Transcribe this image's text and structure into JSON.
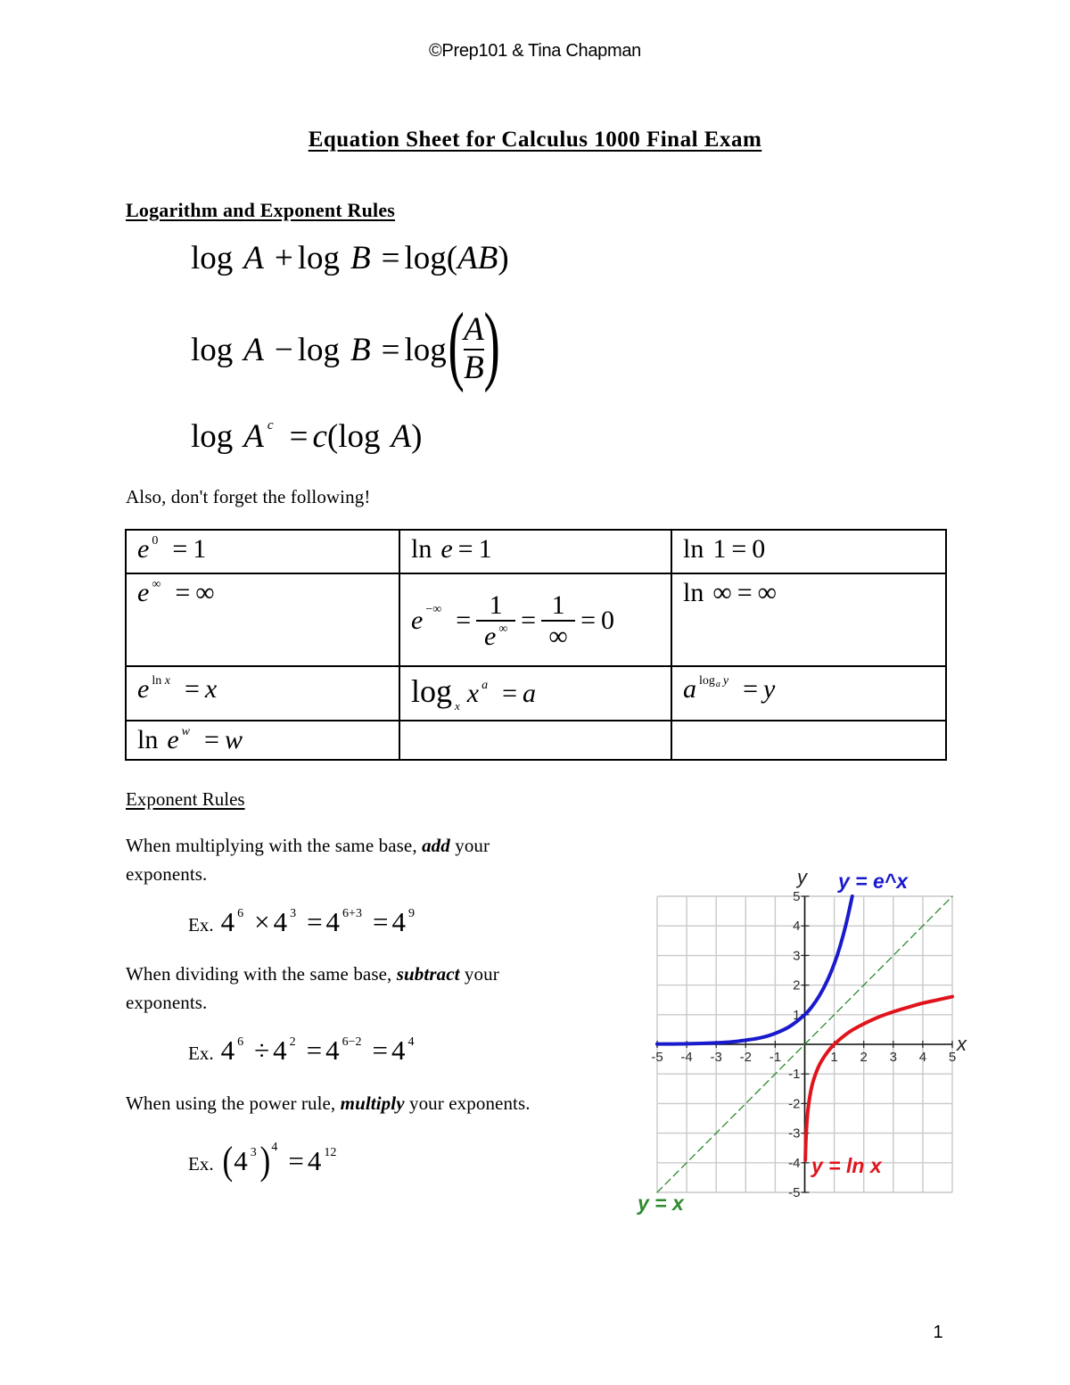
{
  "header": {
    "copyright": "©Prep101 & Tina Chapman"
  },
  "title": "Equation Sheet for Calculus 1000 Final Exam",
  "log_rules": {
    "heading": "Logarithm and Exponent Rules",
    "product": {
      "t1": "log",
      "a": "A",
      "plus": "+",
      "t2": "log",
      "b": "B",
      "eq": "=",
      "t3": "log(",
      "ab": "AB",
      "rp": ")"
    },
    "quotient": {
      "t1": "log",
      "a": "A",
      "minus": "−",
      "t2": "log",
      "b": "B",
      "eq": "=",
      "t3": "log",
      "lp": "(",
      "num": "A",
      "den": "B",
      "rp": ")"
    },
    "power": {
      "t1": "log",
      "a": "A",
      "exp": "c",
      "eq": "=",
      "coef": "c",
      "lp": "(",
      "t2": "log",
      "a2": "A",
      "rp": ")"
    }
  },
  "reminder": "Also, don't forget the following!",
  "identities": {
    "e0": {
      "base": "e",
      "exp": "0",
      "eq": "=",
      "rhs": "1"
    },
    "ln_e": {
      "fn": "ln",
      "arg": "e",
      "eq": "=",
      "rhs": "1"
    },
    "ln_1": {
      "fn": "ln",
      "arg": "1",
      "eq": "=",
      "rhs": "0"
    },
    "e_inf": {
      "base": "e",
      "exp": "∞",
      "eq": "=",
      "rhs": "∞"
    },
    "e_neg_inf": {
      "base": "e",
      "exp": "−∞",
      "eq1": "=",
      "num1": "1",
      "den1_base": "e",
      "den1_exp": "∞",
      "eq2": "=",
      "num2": "1",
      "den2": "∞",
      "eq3": "=",
      "rhs": "0"
    },
    "ln_inf": {
      "fn": "ln",
      "arg": "∞",
      "eq": "=",
      "rhs": "∞"
    },
    "e_ln_x": {
      "base": "e",
      "exp_fn": "ln",
      "exp_arg": "x",
      "eq": "=",
      "rhs": "x"
    },
    "log_x_xa": {
      "fn": "log",
      "sub": "x",
      "base": "x",
      "exp": "a",
      "eq": "=",
      "rhs": "a"
    },
    "a_log_a_y": {
      "base": "a",
      "exp_fn": "log",
      "exp_sub": "a",
      "exp_arg": "y",
      "eq": "=",
      "rhs": "y"
    },
    "ln_e_w": {
      "fn": "ln",
      "base": "e",
      "exp": "w",
      "eq": "=",
      "rhs": "w"
    }
  },
  "exponent_rules": {
    "heading": "Exponent Rules",
    "multiply": {
      "before": "When multiplying with the same base, ",
      "emphasis": "add",
      "after": " your exponents.",
      "example": {
        "label": "Ex.",
        "b1": "4",
        "e1": "6",
        "op": "×",
        "b2": "4",
        "e2": "3",
        "eq1": "=",
        "b3": "4",
        "e3": "6+3",
        "eq2": "=",
        "b4": "4",
        "e4": "9"
      }
    },
    "divide": {
      "before": "When dividing with the same base, ",
      "emphasis": "subtract",
      "after": " your exponents.",
      "example": {
        "label": "Ex.",
        "b1": "4",
        "e1": "6",
        "op": "÷",
        "b2": "4",
        "e2": "2",
        "eq1": "=",
        "b3": "4",
        "e3": "6−2",
        "eq2": "=",
        "b4": "4",
        "e4": "4"
      }
    },
    "power": {
      "before": "When using the power rule, ",
      "emphasis": "multiply",
      "after": " your exponents.",
      "example": {
        "label": "Ex.",
        "lp": "(",
        "b1": "4",
        "e1": "3",
        "rp": ")",
        "outer": "4",
        "eq": "=",
        "b2": "4",
        "e2": "12"
      }
    }
  },
  "chart_data": {
    "type": "line",
    "title": "",
    "xlabel": "x",
    "ylabel": "y",
    "xlim": [
      -5,
      5
    ],
    "ylim": [
      -5,
      5
    ],
    "grid": true,
    "grid_step": 1,
    "xticks": [
      -5,
      -4,
      -3,
      -2,
      -1,
      1,
      2,
      3,
      4,
      5
    ],
    "yticks": [
      5,
      4,
      3,
      2,
      1,
      -1,
      -2,
      -3,
      -4,
      -5
    ],
    "series": [
      {
        "name": "exp",
        "label": "y = e^x",
        "color": "#1a1acd",
        "style": "solid",
        "x": [
          -5,
          -4,
          -3,
          -2.5,
          -2,
          -1.5,
          -1,
          -0.5,
          0,
          0.25,
          0.5,
          0.75,
          1,
          1.2,
          1.4,
          1.61
        ],
        "y": [
          0.01,
          0.02,
          0.05,
          0.08,
          0.14,
          0.22,
          0.37,
          0.61,
          1,
          1.28,
          1.65,
          2.12,
          2.72,
          3.32,
          4.06,
          5.0
        ]
      },
      {
        "name": "ln",
        "label": "y = ln x",
        "color": "#e0141c",
        "style": "solid",
        "x": [
          0.02,
          0.03,
          0.05,
          0.08,
          0.12,
          0.2,
          0.3,
          0.5,
          0.75,
          1,
          1.5,
          2,
          2.5,
          3,
          3.5,
          4,
          4.5,
          5
        ],
        "y": [
          -3.91,
          -3.51,
          -3.0,
          -2.53,
          -2.12,
          -1.61,
          -1.2,
          -0.69,
          -0.29,
          0,
          0.41,
          0.69,
          0.92,
          1.1,
          1.25,
          1.39,
          1.5,
          1.61
        ]
      },
      {
        "name": "identity",
        "label": "y = x",
        "color": "#2e8b2e",
        "style": "dashed",
        "x": [
          -5,
          5
        ],
        "y": [
          -5,
          5
        ]
      }
    ]
  },
  "page_number": "1"
}
